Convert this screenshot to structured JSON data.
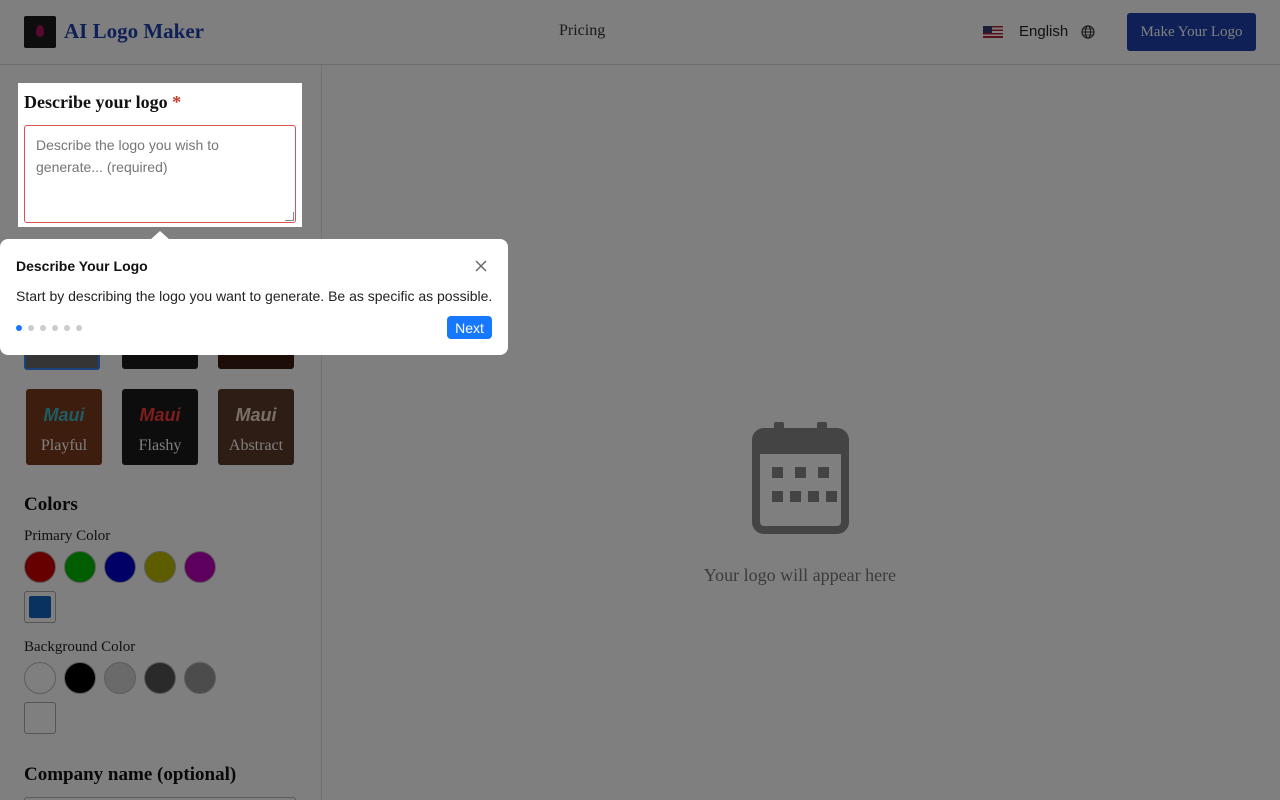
{
  "header": {
    "brand": "AI Logo Maker",
    "nav_pricing": "Pricing",
    "language": "English",
    "cta": "Make Your Logo",
    "icons": {
      "logo": "logo-icon",
      "flag": "us-flag-icon",
      "globe": "globe-icon"
    }
  },
  "sidebar": {
    "describe": {
      "title": "Describe your logo",
      "required_mark": "*",
      "placeholder": "Describe the logo you wish to generate... (required)"
    },
    "styles": [
      {
        "label": "Playful",
        "art": "Maui"
      },
      {
        "label": "Flashy",
        "art": "Maui"
      },
      {
        "label": "Abstract",
        "art": "Maui"
      }
    ],
    "colors": {
      "title": "Colors",
      "primary_label": "Primary Color",
      "primary_swatches": [
        "#cc0000",
        "#00bb00",
        "#0000cc",
        "#bbbb00",
        "#bb00bb"
      ],
      "primary_custom": "#1565c0",
      "background_label": "Background Color",
      "background_swatches": [
        "#ffffff",
        "#000000",
        "#d4d4d4",
        "#555555",
        "#999999"
      ],
      "background_custom": "#ffffff"
    },
    "company": {
      "title": "Company name (optional)"
    }
  },
  "main": {
    "placeholder_text": "Your logo will appear here",
    "placeholder_icon": "calendar-icon"
  },
  "tour": {
    "title": "Describe Your Logo",
    "body": "Start by describing the logo you want to generate. Be as specific as possible.",
    "next": "Next",
    "steps_total": 6,
    "step_current": 1,
    "close_icon": "close-icon"
  }
}
